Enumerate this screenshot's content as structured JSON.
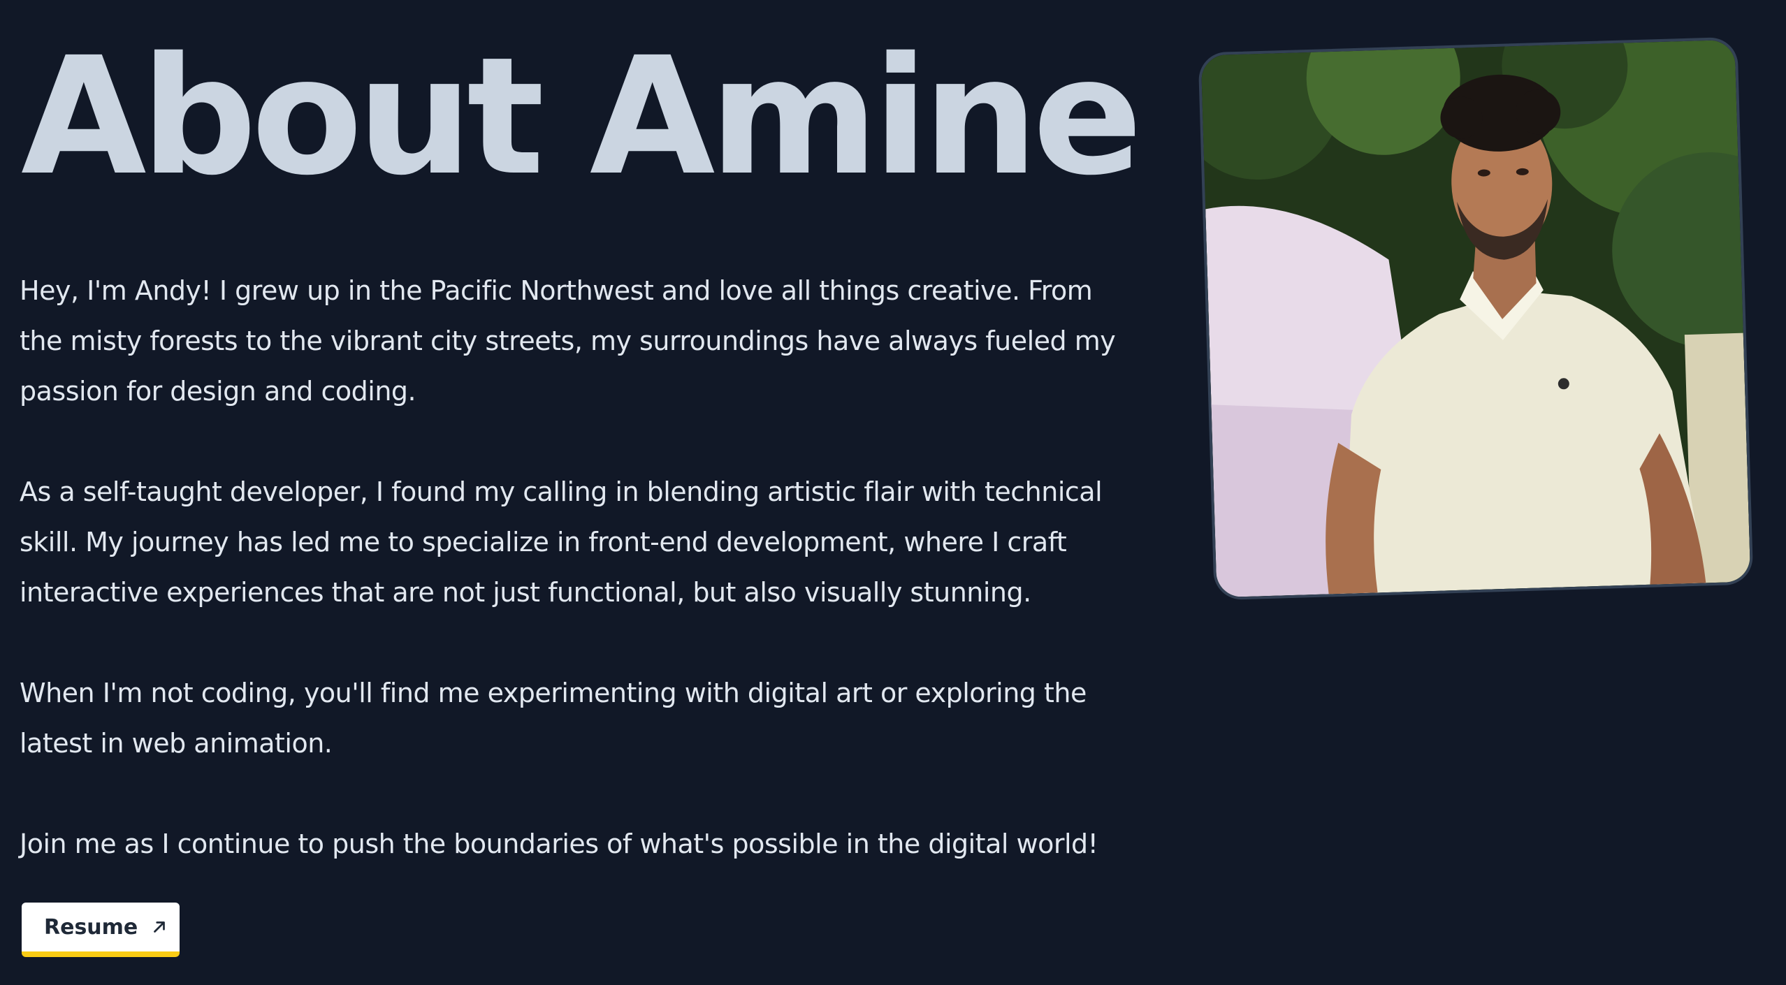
{
  "header": {
    "title": "About Amine"
  },
  "bio": {
    "paragraphs": [
      "Hey, I'm Andy! I grew up in the Pacific Northwest and love all things creative. From the misty forests to the vibrant city streets, my surroundings have always fueled my passion for design and coding.",
      "As a self-taught developer, I found my calling in blending artistic flair with technical skill. My journey has led me to specialize in front-end development, where I craft interactive experiences that are not just functional, but also visually stunning.",
      "When I'm not coding, you'll find me experimenting with digital art or exploring the latest in web animation.",
      "Join me as I continue to push the boundaries of what's possible in the digital world!"
    ]
  },
  "resume_button": {
    "label": "Resume",
    "icon": "arrow-up-right-icon"
  },
  "photo": {
    "subject": "portrait-photo"
  },
  "colors": {
    "background": "#111827",
    "heading": "#cbd5e1",
    "text": "#e2e8f0",
    "button_bg": "#ffffff",
    "button_accent": "#facc15",
    "frame_border": "#334155"
  }
}
